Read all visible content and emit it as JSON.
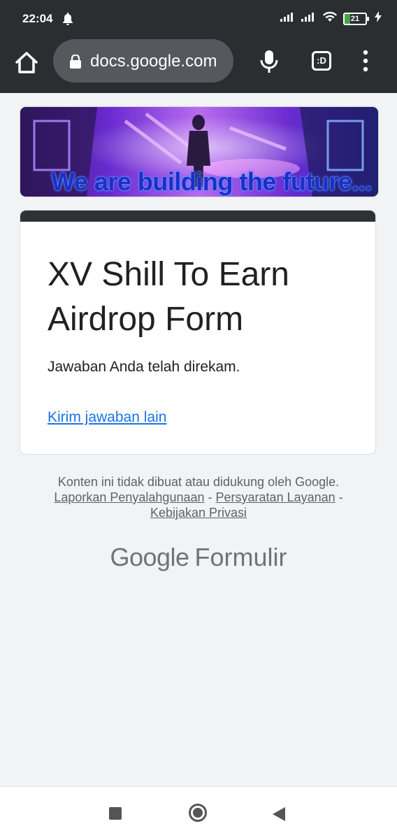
{
  "status_bar": {
    "time": "22:04",
    "battery_level": "21",
    "icons": [
      "notification-bell-icon",
      "signal-icon",
      "signal-icon",
      "wifi-icon",
      "battery-icon",
      "charging-icon"
    ]
  },
  "browser": {
    "url": "docs.google.com",
    "tab_count_label": ":D",
    "icons": [
      "home-icon",
      "lock-icon",
      "mic-icon",
      "tab-switcher-icon",
      "more-vert-icon"
    ]
  },
  "banner": {
    "text": "We are building the future..."
  },
  "form": {
    "title": "XV Shill To Earn Airdrop Form",
    "confirmation": "Jawaban Anda telah direkam.",
    "submit_another_link": "Kirim jawaban lain"
  },
  "footer": {
    "disclaimer": "Konten ini tidak dibuat atau didukung oleh Google.",
    "report_abuse": "Laporkan Penyalahgunaan",
    "separator": "-",
    "terms": "Persyaratan Layanan",
    "privacy": "Kebijakan Privasi",
    "brand_google": "Google",
    "brand_product": "Formulir"
  },
  "nav_bar": {
    "icons": [
      "recents-square-icon",
      "home-circle-icon",
      "back-triangle-icon"
    ]
  },
  "colors": {
    "chrome_dark": "#2b2e31",
    "omnibox": "#55595d",
    "link_blue": "#1a73e8",
    "page_bg": "#f1f3f4",
    "banner_text": "#1c2ec9"
  }
}
